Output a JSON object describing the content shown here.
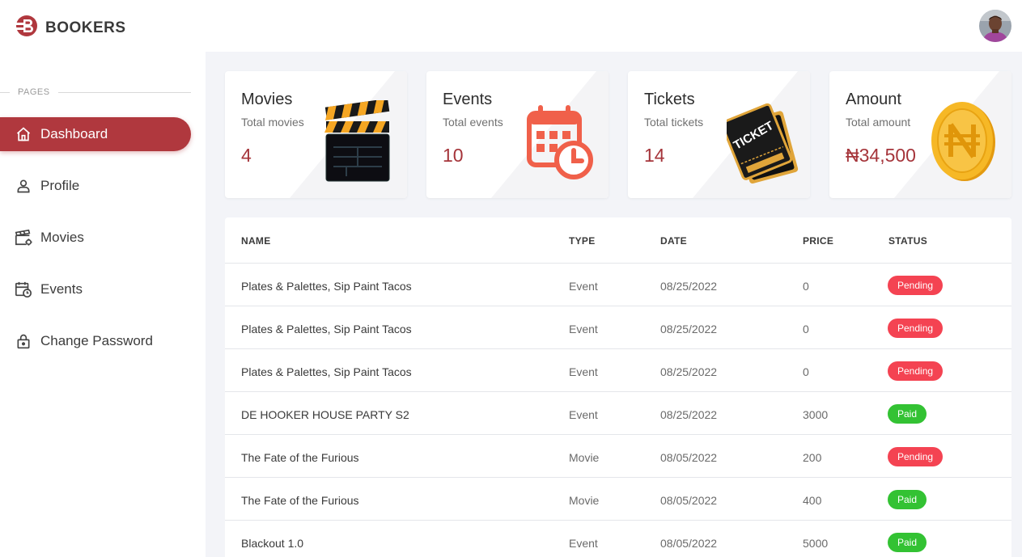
{
  "brand": {
    "name": "BOOKERS",
    "logo_icon": "bookers-logo-icon"
  },
  "user": {
    "avatar_icon": "user-avatar"
  },
  "sidebar": {
    "section_label": "PAGES",
    "items": [
      {
        "label": "Dashboard",
        "icon": "home-icon",
        "active": true
      },
      {
        "label": "Profile",
        "icon": "person-icon",
        "active": false
      },
      {
        "label": "Movies",
        "icon": "clapperboard-icon",
        "active": false
      },
      {
        "label": "Events",
        "icon": "calendar-clock-icon",
        "active": false
      },
      {
        "label": "Change Password",
        "icon": "lock-icon",
        "active": false
      }
    ]
  },
  "stats": [
    {
      "title": "Movies",
      "subtitle": "Total movies",
      "value": "4",
      "icon": "clapperboard-art"
    },
    {
      "title": "Events",
      "subtitle": "Total events",
      "value": "10",
      "icon": "calendar-clock-art"
    },
    {
      "title": "Tickets",
      "subtitle": "Total tickets",
      "value": "14",
      "icon": "ticket-art"
    },
    {
      "title": "Amount",
      "subtitle": "Total amount",
      "value": "₦34,500",
      "icon": "naira-coin-art"
    }
  ],
  "table": {
    "headers": {
      "name": "NAME",
      "type": "TYPE",
      "date": "DATE",
      "price": "PRICE",
      "status": "STATUS"
    },
    "rows": [
      {
        "name": "Plates & Palettes, Sip Paint Tacos",
        "type": "Event",
        "date": "08/25/2022",
        "price": "0",
        "status": "Pending"
      },
      {
        "name": "Plates & Palettes, Sip Paint Tacos",
        "type": "Event",
        "date": "08/25/2022",
        "price": "0",
        "status": "Pending"
      },
      {
        "name": "Plates & Palettes, Sip Paint Tacos",
        "type": "Event",
        "date": "08/25/2022",
        "price": "0",
        "status": "Pending"
      },
      {
        "name": "DE HOOKER HOUSE PARTY S2",
        "type": "Event",
        "date": "08/25/2022",
        "price": "3000",
        "status": "Paid"
      },
      {
        "name": "The Fate of the Furious",
        "type": "Movie",
        "date": "08/05/2022",
        "price": "200",
        "status": "Pending"
      },
      {
        "name": "The Fate of the Furious",
        "type": "Movie",
        "date": "08/05/2022",
        "price": "400",
        "status": "Paid"
      },
      {
        "name": "Blackout 1.0",
        "type": "Event",
        "date": "08/05/2022",
        "price": "5000",
        "status": "Paid"
      }
    ]
  },
  "colors": {
    "accent": "#b0383e",
    "value": "#a5343a",
    "pending": "#f44352",
    "paid": "#33c233"
  }
}
